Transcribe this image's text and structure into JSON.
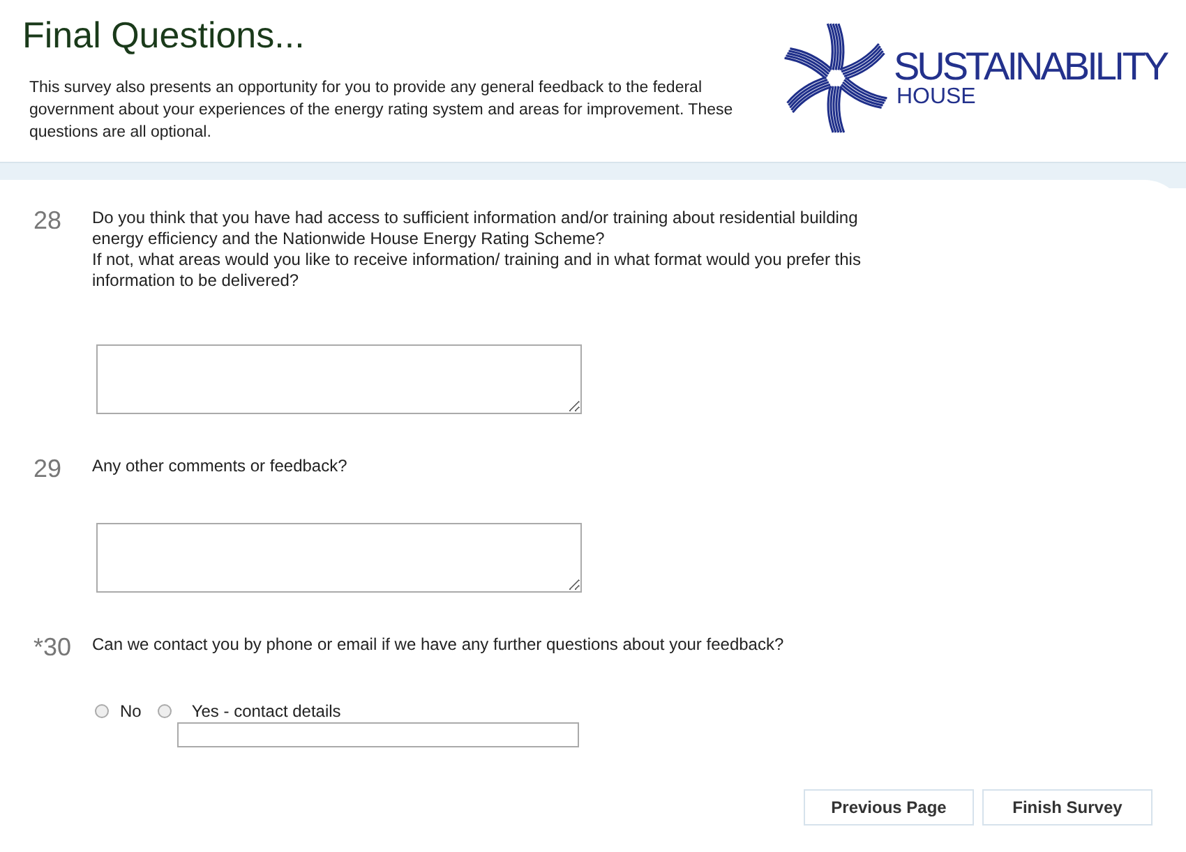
{
  "header": {
    "title": "Final Questions...",
    "intro": "This survey also presents an opportunity for you to provide any general feedback to the federal government about your experiences of the energy rating system and areas for improvement.  These questions are all optional.",
    "logo": {
      "name": "SUSTAINABILITY",
      "sub": "HOUSE"
    }
  },
  "questions": [
    {
      "number": "28",
      "kind": "textarea",
      "paragraphs": [
        "Do you think that you have had access to sufficient information and/or training about residential building energy efficiency and the Nationwide House Energy Rating Scheme?",
        "If not, what areas would you like to receive information/ training and in what format would you prefer this information to be delivered?"
      ]
    },
    {
      "number": "29",
      "kind": "textarea",
      "paragraphs": [
        "Any other comments or feedback?"
      ]
    },
    {
      "number": "*30",
      "kind": "radio",
      "paragraphs": [
        "Can we contact you by phone or email if we have any further questions about your feedback?"
      ],
      "options": [
        {
          "kind": "plain",
          "label": "No",
          "selected": false
        },
        {
          "kind": "field",
          "label": "Yes - contact details",
          "selected": false
        }
      ]
    }
  ],
  "buttons": [
    "Previous Page",
    "Finish Survey"
  ]
}
